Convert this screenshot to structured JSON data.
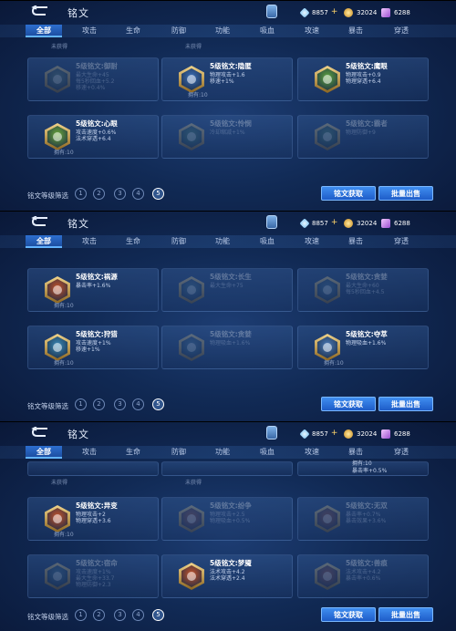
{
  "colors": {
    "accent": "#2d6fd0",
    "panel": "#112a55"
  },
  "icons": {
    "back": "back-arrow-icon",
    "bag": "rune-bag-icon",
    "diamond": "diamond-icon",
    "gold": "gold-coin-icon",
    "gem": "gem-icon"
  },
  "panels": [
    {
      "header": {
        "title": "铭文",
        "diamond": "8857",
        "gold": "32024",
        "gem": "6288"
      },
      "tabs": [
        {
          "label": "全部",
          "active": true
        },
        {
          "label": "攻击"
        },
        {
          "label": "生命"
        },
        {
          "label": "防御"
        },
        {
          "label": "功能"
        },
        {
          "label": "吸血"
        },
        {
          "label": "攻速"
        },
        {
          "label": "暴击"
        },
        {
          "label": "穿透"
        }
      ],
      "top_labels": [
        "未获得",
        "未获得"
      ],
      "cards": [
        {
          "dim": true,
          "name": "5级铭文:御耐",
          "stats": [
            "最大生命+45",
            "每5秒回血+5.2",
            "移速+0.4%"
          ],
          "owned": "",
          "gem": "#6b8a7a"
        },
        {
          "dim": false,
          "name": "5级铭文:隐匿",
          "stats": [
            "物理攻击+1.6",
            "移速+1%"
          ],
          "owned": "拥有:10",
          "gem": "#3a6fb8"
        },
        {
          "dim": false,
          "name": "5级铭文:鹰眼",
          "stats": [
            "物理攻击+0.9",
            "物理穿透+6.4"
          ],
          "owned": "",
          "gem": "#5da43e"
        },
        {
          "dim": false,
          "name": "5级铭文:心眼",
          "stats": [
            "攻击速度+0.6%",
            "法术穿透+6.4"
          ],
          "owned": "拥有:10",
          "gem": "#6aa83a"
        },
        {
          "dim": true,
          "name": "5级铭文:怜悯",
          "stats": [
            "冷却缩减+1%"
          ],
          "owned": "",
          "gem": "#4f8a6a"
        },
        {
          "dim": true,
          "name": "5级铭文:霸者",
          "stats": [
            "物理防御+9"
          ],
          "owned": "",
          "gem": "#4f8a6a"
        }
      ],
      "footer": {
        "filter_label": "铭文等级筛选",
        "levels": [
          "1",
          "2",
          "3",
          "4",
          "5"
        ],
        "get_button": "铭文获取",
        "sell_button": "批量出售"
      }
    },
    {
      "header": {
        "title": "铭文",
        "diamond": "8857",
        "gold": "32024",
        "gem": "6288"
      },
      "tabs": [
        {
          "label": "全部",
          "active": true
        },
        {
          "label": "攻击"
        },
        {
          "label": "生命"
        },
        {
          "label": "防御"
        },
        {
          "label": "功能"
        },
        {
          "label": "吸血"
        },
        {
          "label": "攻速"
        },
        {
          "label": "暴击"
        },
        {
          "label": "穿透"
        }
      ],
      "cards": [
        {
          "dim": false,
          "name": "5级铭文:祸源",
          "stats": [
            "暴击率+1.6%"
          ],
          "owned": "拥有:10",
          "gem": "#c4532a"
        },
        {
          "dim": true,
          "name": "5级铭文:长生",
          "stats": [
            "最大生命+75"
          ],
          "owned": "",
          "gem": "#4a7a9a"
        },
        {
          "dim": true,
          "name": "5级铭文:贪婪",
          "stats": [
            "最大生命+60",
            "每5秒回血+4.5"
          ],
          "owned": "",
          "gem": "#4a7a9a"
        },
        {
          "dim": false,
          "name": "5级铭文:狩猎",
          "stats": [
            "攻击速度+1%",
            "移速+1%"
          ],
          "owned": "拥有:10",
          "gem": "#3a8ab8"
        },
        {
          "dim": true,
          "name": "5级铭文:贪婪",
          "stats": [
            "物理吸血+1.6%"
          ],
          "owned": "",
          "gem": "#4a7a9a"
        },
        {
          "dim": false,
          "name": "5级铭文:夺萃",
          "stats": [
            "物理吸血+1.6%"
          ],
          "owned": "拥有:10",
          "gem": "#4a7ab8"
        }
      ],
      "footer": {
        "filter_label": "铭文等级筛选",
        "levels": [
          "1",
          "2",
          "3",
          "4",
          "5"
        ],
        "get_button": "铭文获取",
        "sell_button": "批量出售"
      }
    },
    {
      "header": {
        "title": "铭文",
        "diamond": "8857",
        "gold": "32024",
        "gem": "6288"
      },
      "tabs": [
        {
          "label": "全部",
          "active": true
        },
        {
          "label": "攻击"
        },
        {
          "label": "生命"
        },
        {
          "label": "防御"
        },
        {
          "label": "功能"
        },
        {
          "label": "吸血"
        },
        {
          "label": "攻速"
        },
        {
          "label": "暴击"
        },
        {
          "label": "穿透"
        }
      ],
      "top_labels": [
        "未获得",
        "未获得",
        "暴击率+0.5%"
      ],
      "top_owned": "拥有:10",
      "cards": [
        {
          "dim": false,
          "name": "5级铭文:异变",
          "stats": [
            "物理攻击+2",
            "物理穿透+3.6"
          ],
          "owned": "拥有:10",
          "gem": "#c4532a"
        },
        {
          "dim": true,
          "name": "5级铭文:纷争",
          "stats": [
            "物理攻击+2.5",
            "物理吸血+0.5%"
          ],
          "owned": "",
          "gem": "#a8503a"
        },
        {
          "dim": true,
          "name": "5级铭文:无双",
          "stats": [
            "暴击率+0.7%",
            "暴击效果+3.6%"
          ],
          "owned": "",
          "gem": "#a8503a"
        },
        {
          "dim": true,
          "name": "5级铭文:宿命",
          "stats": [
            "攻击速度+1%",
            "最大生命+33.7",
            "物理防御+2.3"
          ],
          "owned": "",
          "gem": "#4a7a9a"
        },
        {
          "dim": false,
          "name": "5级铭文:梦魇",
          "stats": [
            "法术攻击+4.2",
            "法术穿透+2.4"
          ],
          "owned": "",
          "gem": "#c4532a"
        },
        {
          "dim": true,
          "name": "5级铭文:兽痕",
          "stats": [
            "法术攻击+4.2",
            "暴击率+0.6%"
          ],
          "owned": "",
          "gem": "#a8503a"
        }
      ],
      "footer": {
        "filter_label": "铭文等级筛选",
        "levels": [
          "1",
          "2",
          "3",
          "4",
          "5"
        ],
        "get_button": "铭文获取",
        "sell_button": "批量出售"
      }
    }
  ]
}
